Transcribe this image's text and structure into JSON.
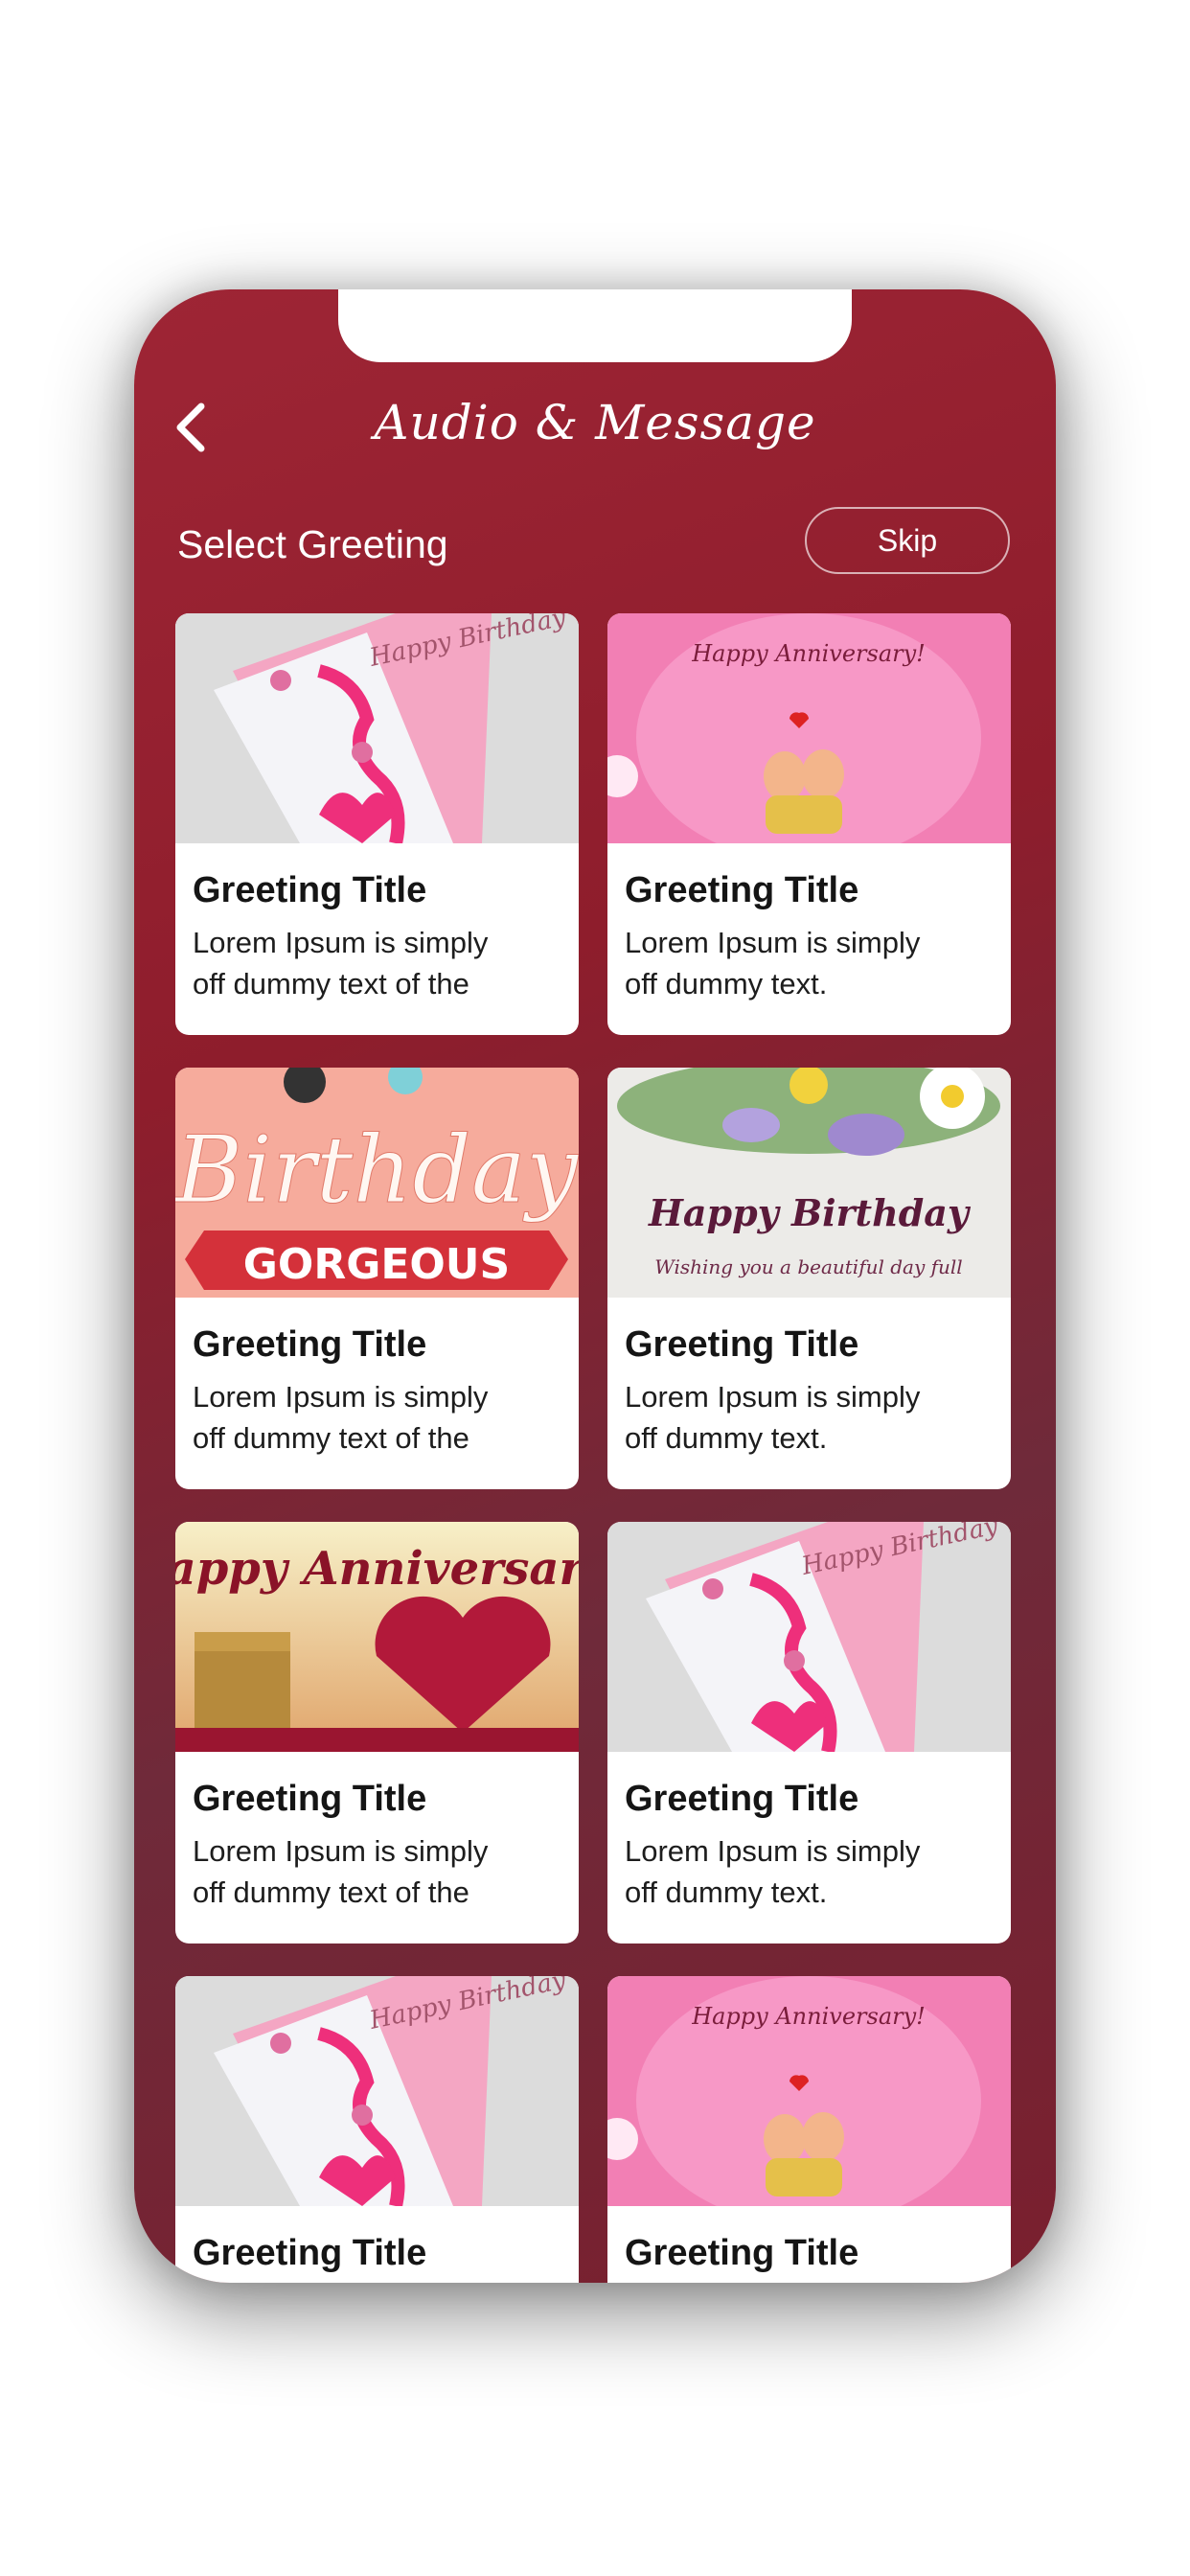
{
  "header": {
    "title": "Audio & Message",
    "back_icon": "chevron-left-icon"
  },
  "section": {
    "heading": "Select Greeting",
    "skip_label": "Skip"
  },
  "cards": [
    {
      "title": "Greeting Title",
      "desc_line1": "Lorem Ipsum is simply",
      "desc_line2": "off dummy text of the",
      "image": "happy-birthday-butterfly-card",
      "image_text": "Happy Birthday"
    },
    {
      "title": "Greeting Title",
      "desc_line1": "Lorem Ipsum is simply",
      "desc_line2": "off dummy text.",
      "image": "happy-anniversary-pink-couple",
      "image_text": "Happy Anniversary!"
    },
    {
      "title": "Greeting Title",
      "desc_line1": "Lorem Ipsum is simply",
      "desc_line2": "off dummy text of the",
      "image": "birthday-gorgeous-peach",
      "image_text": "Birthday",
      "image_banner": "GORGEOUS"
    },
    {
      "title": "Greeting Title",
      "desc_line1": "Lorem Ipsum is simply",
      "desc_line2": "off dummy text.",
      "image": "happy-birthday-flowers",
      "image_text": "Happy Birthday",
      "image_subtext": "Wishing you a beautiful day full"
    },
    {
      "title": "Greeting Title",
      "desc_line1": "Lorem Ipsum is simply",
      "desc_line2": "off dummy text of the",
      "image": "happy-anniversary-heart-gift",
      "image_text": "Happy Anniversary!"
    },
    {
      "title": "Greeting Title",
      "desc_line1": "Lorem Ipsum is simply",
      "desc_line2": "off dummy text.",
      "image": "happy-birthday-butterfly-card",
      "image_text": "Happy Birthday"
    },
    {
      "title": "Greeting Title",
      "desc_line1": "",
      "desc_line2": "",
      "image": "happy-birthday-butterfly-card",
      "image_text": "Happy Birthday"
    },
    {
      "title": "Greeting Title",
      "desc_line1": "",
      "desc_line2": "",
      "image": "happy-anniversary-pink-couple",
      "image_text": "Happy Anniversary!"
    }
  ],
  "colors": {
    "background_top": "#9e2535",
    "background_mid": "#6f2a3a",
    "card_bg": "#ffffff",
    "accent_pink": "#ee2f7b"
  }
}
